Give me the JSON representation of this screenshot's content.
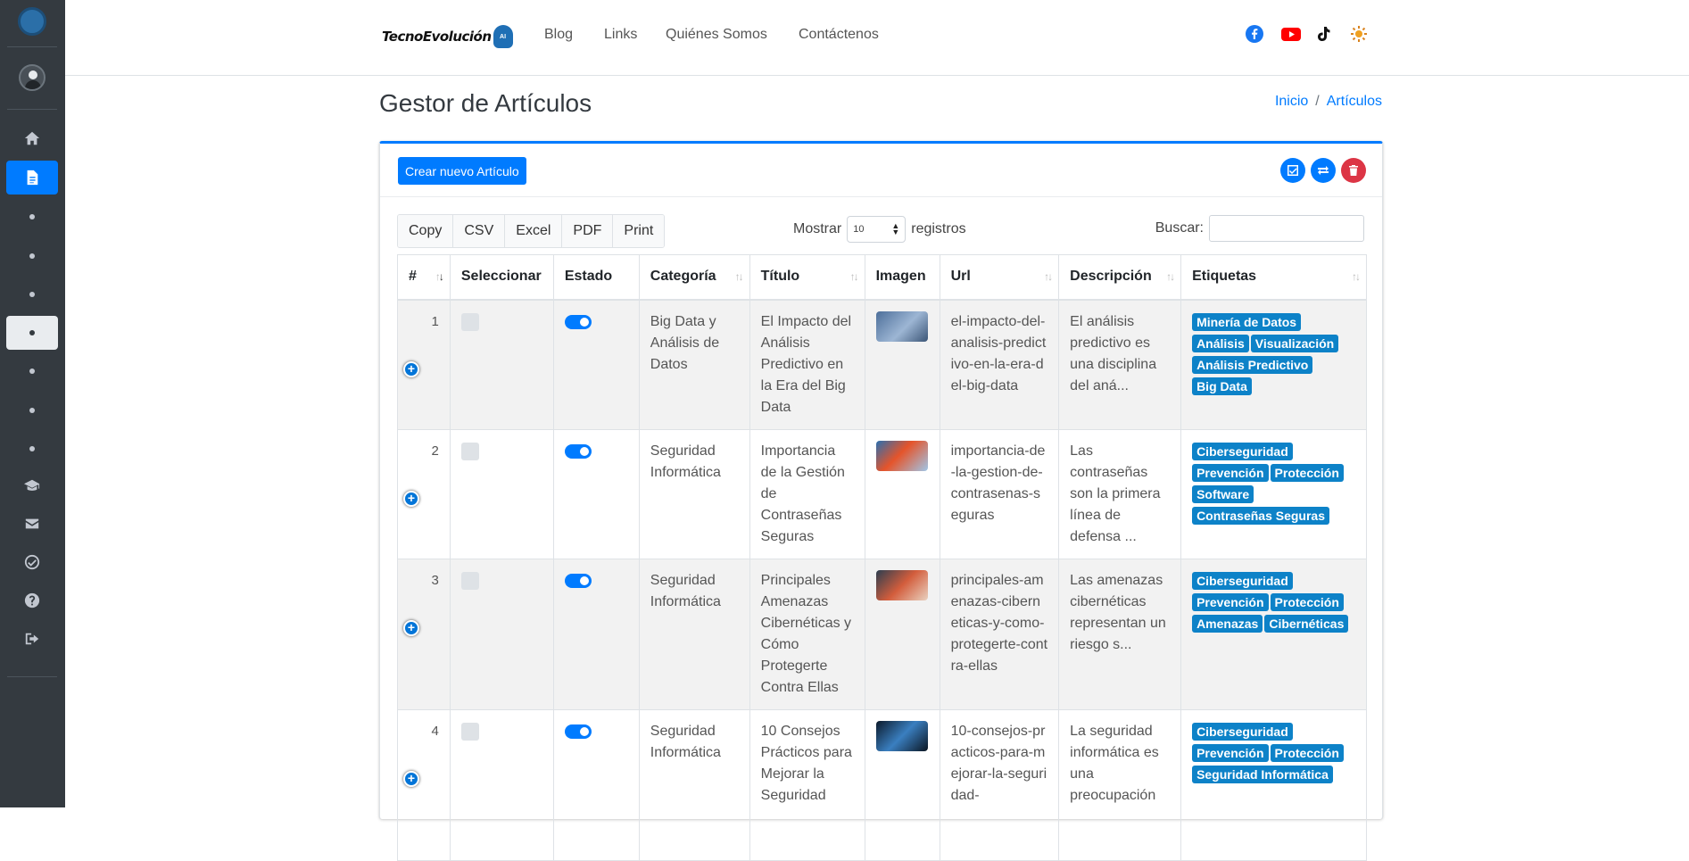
{
  "brand": {
    "name": "TecnoEvolución",
    "badge": "AI"
  },
  "nav": [
    "Blog",
    "Links",
    "Quiénes Somos",
    "Contáctenos"
  ],
  "social": [
    "facebook-icon",
    "youtube-icon",
    "tiktok-icon",
    "sun-icon"
  ],
  "page": {
    "title": "Gestor de Artículos"
  },
  "breadcrumb": {
    "home": "Inicio",
    "separator": "/",
    "current": "Artículos"
  },
  "card": {
    "create_label": "Crear nuevo Artículo"
  },
  "export_buttons": [
    "Copy",
    "CSV",
    "Excel",
    "PDF",
    "Print"
  ],
  "length": {
    "prefix": "Mostrar",
    "value": "10",
    "suffix": "registros"
  },
  "search": {
    "label": "Buscar:"
  },
  "columns": [
    "#",
    "Seleccionar",
    "Estado",
    "Categoría",
    "Título",
    "Imagen",
    "Url",
    "Descripción",
    "Etiquetas"
  ],
  "rows": [
    {
      "num": "1",
      "categoria": "Big Data y Análisis de Datos",
      "titulo": "El Impacto del Análisis Predictivo en la Era del Big Data",
      "url": "el-impacto-del-analisis-predictivo-en-la-era-del-big-data",
      "descripcion": "El análisis predictivo es una disciplina del aná...",
      "etiquetas": [
        "Minería de Datos",
        "Análisis",
        "Visualización",
        "Análisis Predictivo",
        "Big Data"
      ]
    },
    {
      "num": "2",
      "categoria": "Seguridad Informática",
      "titulo": "Importancia de la Gestión de Contraseñas Seguras",
      "url": "importancia-de-la-gestion-de-contrasenas-seguras",
      "descripcion": "Las contraseñas son la primera línea de defensa ...",
      "etiquetas": [
        "Ciberseguridad",
        "Prevención",
        "Protección",
        "Software",
        "Contraseñas Seguras"
      ]
    },
    {
      "num": "3",
      "categoria": "Seguridad Informática",
      "titulo": "Principales Amenazas Cibernéticas y Cómo Protegerte Contra Ellas",
      "url": "principales-amenazas-ciberneticas-y-como-protegerte-contra-ellas",
      "descripcion": "Las amenazas cibernéticas representan un riesgo s...",
      "etiquetas": [
        "Ciberseguridad",
        "Prevención",
        "Protección",
        "Amenazas",
        "Cibernéticas"
      ]
    },
    {
      "num": "4",
      "categoria": "Seguridad Informática",
      "titulo": "10 Consejos Prácticos para Mejorar la Seguridad",
      "url": "10-consejos-practicos-para-mejorar-la-seguridad-",
      "descripcion": "La seguridad informática es una preocupación",
      "etiquetas": [
        "Ciberseguridad",
        "Prevención",
        "Protección",
        "Seguridad Informática"
      ]
    }
  ],
  "colors": {
    "primary": "#007bff",
    "danger": "#dc3545",
    "tag": "#0d82c8",
    "sidebar": "#343a40"
  }
}
